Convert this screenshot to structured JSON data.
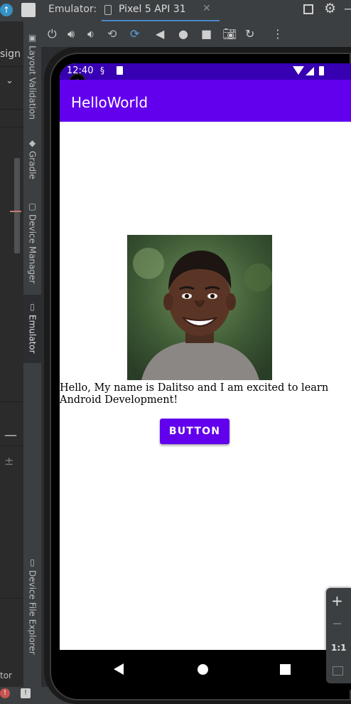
{
  "ide": {
    "left_panel": {
      "design_tab_label": "sign",
      "bottom_label": "tor"
    },
    "side_tabs": [
      {
        "label": "Layout Validation"
      },
      {
        "label": "Gradle"
      },
      {
        "label": "Device Manager"
      },
      {
        "label": "Emulator"
      },
      {
        "label": "Device File Explorer"
      }
    ]
  },
  "emulator": {
    "title": "Emulator:",
    "device_tab": "Pixel 5 API 31",
    "toolbar_icons": [
      "power-icon",
      "volume-up-icon",
      "volume-down-icon",
      "rotate-left-icon",
      "rotate-right-icon",
      "back-icon",
      "home-icon",
      "overview-icon",
      "screenshot-icon",
      "snapshot-icon",
      "more-icon"
    ],
    "zoom": {
      "in": "+",
      "out": "−",
      "actual": "1:1"
    }
  },
  "phone": {
    "status_time": "12:40",
    "app_title": "HelloWorld",
    "intro_text": "Hello, My name is Dalitso and I am excited to learn Android Development!",
    "button_label": "BUTTON",
    "colors": {
      "primary": "#6200ee",
      "primary_dark": "#3700b3"
    }
  }
}
